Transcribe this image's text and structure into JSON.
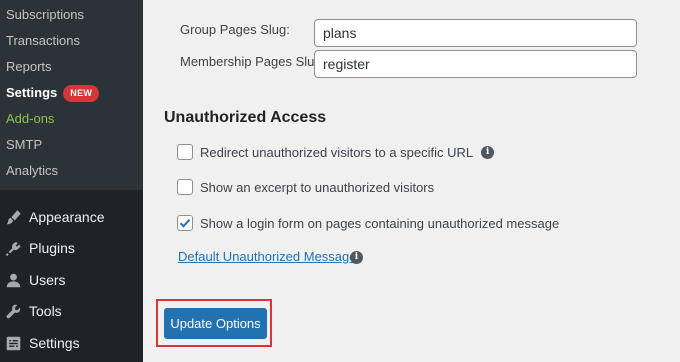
{
  "sidebar": {
    "submenu": [
      {
        "label": "Subscriptions"
      },
      {
        "label": "Transactions"
      },
      {
        "label": "Reports"
      },
      {
        "label": "Settings",
        "badge": "NEW"
      },
      {
        "label": "Add-ons"
      },
      {
        "label": "SMTP"
      },
      {
        "label": "Analytics"
      }
    ],
    "menu": [
      {
        "label": "Appearance",
        "icon": "paintbrush-icon"
      },
      {
        "label": "Plugins",
        "icon": "plugin-icon"
      },
      {
        "label": "Users",
        "icon": "user-icon"
      },
      {
        "label": "Tools",
        "icon": "wrench-icon"
      },
      {
        "label": "Settings",
        "icon": "settings-icon"
      }
    ]
  },
  "fields": {
    "group_slug": {
      "label": "Group Pages Slug:",
      "value": "plans"
    },
    "membership_slug": {
      "label": "Membership Pages Slug:",
      "value": "register"
    }
  },
  "unauthorized": {
    "title": "Unauthorized Access",
    "options": [
      {
        "label": "Redirect unauthorized visitors to a specific URL",
        "checked": false,
        "info": true
      },
      {
        "label": "Show an excerpt to unauthorized visitors",
        "checked": false,
        "info": false
      },
      {
        "label": "Show a login form on pages containing unauthorized message",
        "checked": true,
        "info": false
      }
    ],
    "default_message_link": "Default Unauthorized Message:"
  },
  "actions": {
    "update_label": "Update Options"
  },
  "colors": {
    "accent": "#2271b1",
    "highlight": "#d63638",
    "badge": "#d63638",
    "addons": "#8ac34a"
  }
}
